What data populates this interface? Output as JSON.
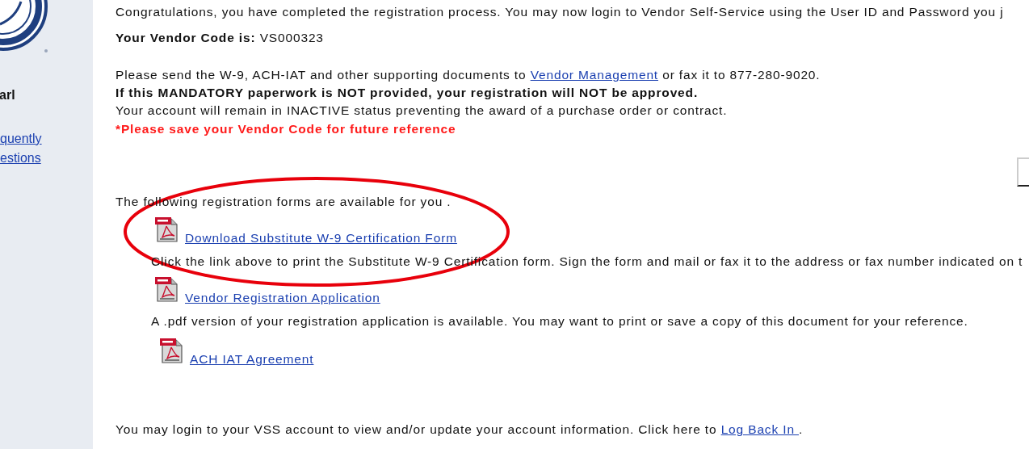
{
  "sidebar": {
    "heading": "arl",
    "links": [
      "quently",
      "estions"
    ]
  },
  "confirmation": {
    "intro": "Congratulations, you have completed the registration process. You may now login to Vendor Self-Service using the User ID and Password you j",
    "code_label": "Your Vendor Code is:",
    "code": "VS000323"
  },
  "notice": {
    "before": "Please send the W-9, ACH-IAT and other supporting documents to",
    "link": "Vendor Management",
    "after": "or fax it to 877-280-9020.",
    "warning": "If this MANDATORY paperwork is NOT provided, your registration will NOT be approved.",
    "status": "Your account will remain in INACTIVE status preventing the award of a purchase order or contract.",
    "reminder": "*Please save your Vendor Code for future reference"
  },
  "forms_intro": "The following registration forms are available for you .",
  "forms": [
    {
      "link": "Download Substitute W-9 Certification Form",
      "description": "Click the link above to print the Substitute W-9 Certification form. Sign the form and mail or fax it to the address or fax number indicated on t"
    },
    {
      "link": "Vendor Registration Application",
      "description": "A .pdf version of your registration application is available. You may want to print or save a copy of this document for your reference."
    },
    {
      "link": "ACH IAT Agreement"
    }
  ],
  "footer": {
    "text": "You may login to your VSS account to view and/or update your account information. Click here to",
    "link": "Log Back In ",
    "after": "."
  }
}
